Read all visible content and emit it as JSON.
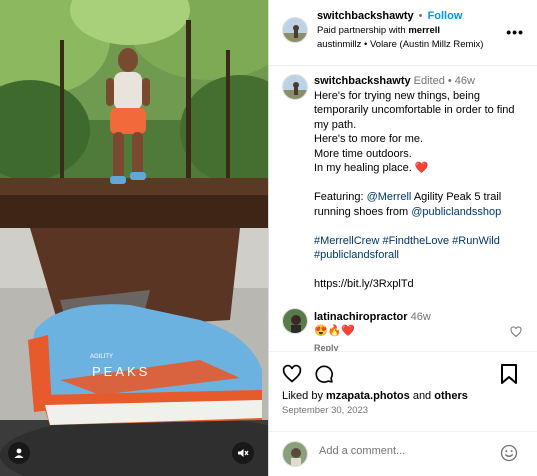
{
  "header": {
    "username": "switchbackshawty",
    "follow_label": "Follow",
    "paid_prefix": "Paid partnership with ",
    "partner": "merrell",
    "audio_artist": "austinmillz",
    "audio_track": "Volare (Austin Millz Remix)"
  },
  "caption": {
    "username": "switchbackshawty",
    "meta": "Edited • 46w",
    "lines": [
      "Here's for trying new things, being temporarily uncomfortable in order to find my path.",
      "Here's to more for me.",
      "More time outdoors.",
      "In my healing place. ❤️"
    ],
    "featuring_prefix": "Featuring: ",
    "featuring_tag1": "@Merrell",
    "featuring_middle": " Agility Peak 5 trail running shoes from ",
    "featuring_tag2": "@publiclandsshop",
    "hashtags": "#MerrellCrew #FindtheLove #RunWild #publiclandsforall",
    "link": "https://bit.ly/3RxplTd"
  },
  "comment": {
    "username": "latinachiropractor",
    "time": "46w",
    "text": "😍🔥❤️",
    "reply_label": "Reply"
  },
  "likes": {
    "prefix": "Liked by ",
    "user": "mzapata.photos",
    "middle": " and ",
    "others": "others"
  },
  "date": "September 30, 2023",
  "add_comment": {
    "placeholder": "Add a comment..."
  },
  "media": {
    "shoe_brand": "AGILITY",
    "shoe_model": "PEAKS"
  },
  "colors": {
    "follow": "#0095f6",
    "tag": "#00376b",
    "muted": "#737373"
  }
}
